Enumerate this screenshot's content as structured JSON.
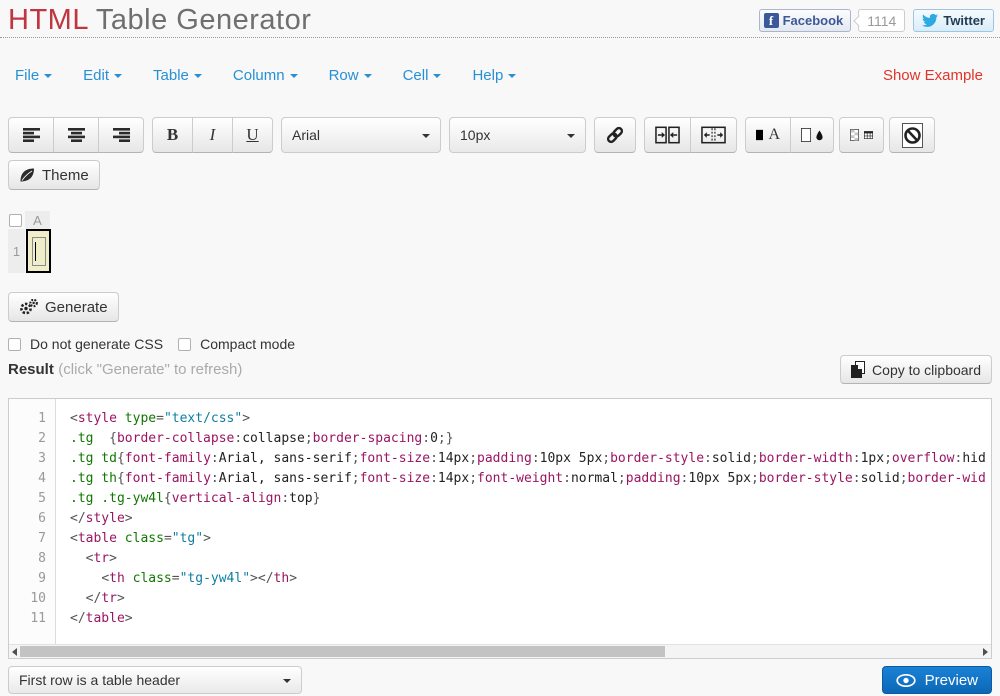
{
  "header": {
    "title_accent": "HTML",
    "title_rest": " Table Generator",
    "facebook_label": "Facebook",
    "facebook_f": "f",
    "share_count": "1114",
    "twitter_label": "Twitter"
  },
  "menubar": {
    "items": [
      {
        "label": "File"
      },
      {
        "label": "Edit"
      },
      {
        "label": "Table"
      },
      {
        "label": "Column"
      },
      {
        "label": "Row"
      },
      {
        "label": "Cell"
      },
      {
        "label": "Help"
      }
    ],
    "show_example": "Show Example"
  },
  "toolbar": {
    "bold": "B",
    "italic": "I",
    "underline": "U",
    "font_family": "Arial",
    "font_size": "10px",
    "icons": [
      "align-left-icon",
      "align-center-icon",
      "align-right-icon",
      "link-icon",
      "merge-cells-icon",
      "split-cell-icon",
      "text-color-icon",
      "fill-color-icon",
      "table-background-icon",
      "clear-formatting-icon"
    ],
    "theme_label": "Theme"
  },
  "grid": {
    "column_header": "A",
    "row_header": "1"
  },
  "generate_label": "Generate",
  "options": {
    "no_css_label": "Do not generate CSS",
    "compact_label": "Compact mode"
  },
  "result": {
    "label": "Result",
    "hint": "(click \"Generate\" to refresh)",
    "copy_label": "Copy to clipboard"
  },
  "code": {
    "lines": [
      [
        [
          "pn",
          "<"
        ],
        [
          "tag",
          "style"
        ],
        [
          "pln",
          " "
        ],
        [
          "attr",
          "type"
        ],
        [
          "pn",
          "="
        ],
        [
          "str",
          "\"text/css\""
        ],
        [
          "pn",
          ">"
        ]
      ],
      [
        [
          "sel",
          ".tg"
        ],
        [
          "pln",
          "  "
        ],
        [
          "pn",
          "{"
        ],
        [
          "prop",
          "border-collapse"
        ],
        [
          "pn",
          ":"
        ],
        [
          "val",
          "collapse"
        ],
        [
          "pn",
          ";"
        ],
        [
          "prop",
          "border-spacing"
        ],
        [
          "pn",
          ":"
        ],
        [
          "val",
          "0"
        ],
        [
          "pn",
          ";}"
        ]
      ],
      [
        [
          "sel",
          ".tg td"
        ],
        [
          "pn",
          "{"
        ],
        [
          "prop",
          "font-family"
        ],
        [
          "pn",
          ":"
        ],
        [
          "val",
          "Arial, sans-serif"
        ],
        [
          "pn",
          ";"
        ],
        [
          "prop",
          "font-size"
        ],
        [
          "pn",
          ":"
        ],
        [
          "val",
          "14px"
        ],
        [
          "pn",
          ";"
        ],
        [
          "prop",
          "padding"
        ],
        [
          "pn",
          ":"
        ],
        [
          "val",
          "10px 5px"
        ],
        [
          "pn",
          ";"
        ],
        [
          "prop",
          "border-style"
        ],
        [
          "pn",
          ":"
        ],
        [
          "val",
          "solid"
        ],
        [
          "pn",
          ";"
        ],
        [
          "prop",
          "border-width"
        ],
        [
          "pn",
          ":"
        ],
        [
          "val",
          "1px"
        ],
        [
          "pn",
          ";"
        ],
        [
          "prop",
          "overflow"
        ],
        [
          "pn",
          ":"
        ],
        [
          "val",
          "hid"
        ]
      ],
      [
        [
          "sel",
          ".tg th"
        ],
        [
          "pn",
          "{"
        ],
        [
          "prop",
          "font-family"
        ],
        [
          "pn",
          ":"
        ],
        [
          "val",
          "Arial, sans-serif"
        ],
        [
          "pn",
          ";"
        ],
        [
          "prop",
          "font-size"
        ],
        [
          "pn",
          ":"
        ],
        [
          "val",
          "14px"
        ],
        [
          "pn",
          ";"
        ],
        [
          "prop",
          "font-weight"
        ],
        [
          "pn",
          ":"
        ],
        [
          "val",
          "normal"
        ],
        [
          "pn",
          ";"
        ],
        [
          "prop",
          "padding"
        ],
        [
          "pn",
          ":"
        ],
        [
          "val",
          "10px 5px"
        ],
        [
          "pn",
          ";"
        ],
        [
          "prop",
          "border-style"
        ],
        [
          "pn",
          ":"
        ],
        [
          "val",
          "solid"
        ],
        [
          "pn",
          ";"
        ],
        [
          "prop",
          "border-wid"
        ]
      ],
      [
        [
          "sel",
          ".tg .tg-yw4l"
        ],
        [
          "pn",
          "{"
        ],
        [
          "prop",
          "vertical-align"
        ],
        [
          "pn",
          ":"
        ],
        [
          "val",
          "top"
        ],
        [
          "pn",
          "}"
        ]
      ],
      [
        [
          "pn",
          "</"
        ],
        [
          "tag",
          "style"
        ],
        [
          "pn",
          ">"
        ]
      ],
      [
        [
          "pn",
          "<"
        ],
        [
          "tag",
          "table"
        ],
        [
          "pln",
          " "
        ],
        [
          "attr",
          "class"
        ],
        [
          "pn",
          "="
        ],
        [
          "str",
          "\"tg\""
        ],
        [
          "pn",
          ">"
        ]
      ],
      [
        [
          "pln",
          "  "
        ],
        [
          "pn",
          "<"
        ],
        [
          "tag",
          "tr"
        ],
        [
          "pn",
          ">"
        ]
      ],
      [
        [
          "pln",
          "    "
        ],
        [
          "pn",
          "<"
        ],
        [
          "tag",
          "th"
        ],
        [
          "pln",
          " "
        ],
        [
          "attr",
          "class"
        ],
        [
          "pn",
          "="
        ],
        [
          "str",
          "\"tg-yw4l\""
        ],
        [
          "pn",
          ">"
        ],
        [
          "pn",
          "</"
        ],
        [
          "tag",
          "th"
        ],
        [
          "pn",
          ">"
        ]
      ],
      [
        [
          "pln",
          "  "
        ],
        [
          "pn",
          "</"
        ],
        [
          "tag",
          "tr"
        ],
        [
          "pn",
          ">"
        ]
      ],
      [
        [
          "pn",
          "</"
        ],
        [
          "tag",
          "table"
        ],
        [
          "pn",
          ">"
        ]
      ]
    ]
  },
  "footer": {
    "header_option": "First row is a table header",
    "preview_label": "Preview"
  },
  "colors": {
    "title_accent": "#c13540",
    "title_rest": "#6f6f6f",
    "menu_link": "#2790d4",
    "show_example": "#e0352b",
    "preview_button": "#0d67b5",
    "cell_selected_bg": "#f0edcb",
    "syntax_tag": "#9b1563",
    "syntax_attr": "#117700",
    "syntax_string": "#0e7ea0",
    "syntax_punct": "#555555",
    "twitter_bird": "#2caae1",
    "facebook_blue": "#3b5998"
  }
}
